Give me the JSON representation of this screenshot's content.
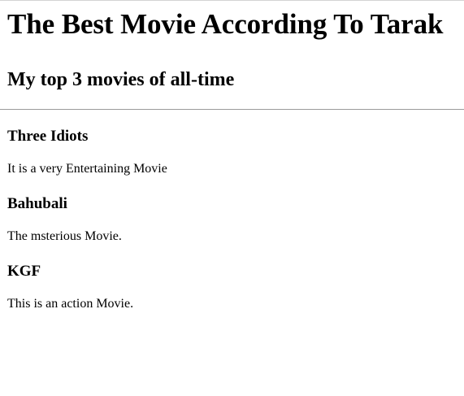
{
  "page": {
    "heading": "The Best Movie According To Tarak",
    "subheading": "My top 3 movies of all-time"
  },
  "movies": [
    {
      "title": "Three Idiots",
      "description": "It is a very Entertaining Movie"
    },
    {
      "title": "Bahubali",
      "description": "The msterious Movie."
    },
    {
      "title": "KGF",
      "description": "This is an action Movie."
    }
  ]
}
